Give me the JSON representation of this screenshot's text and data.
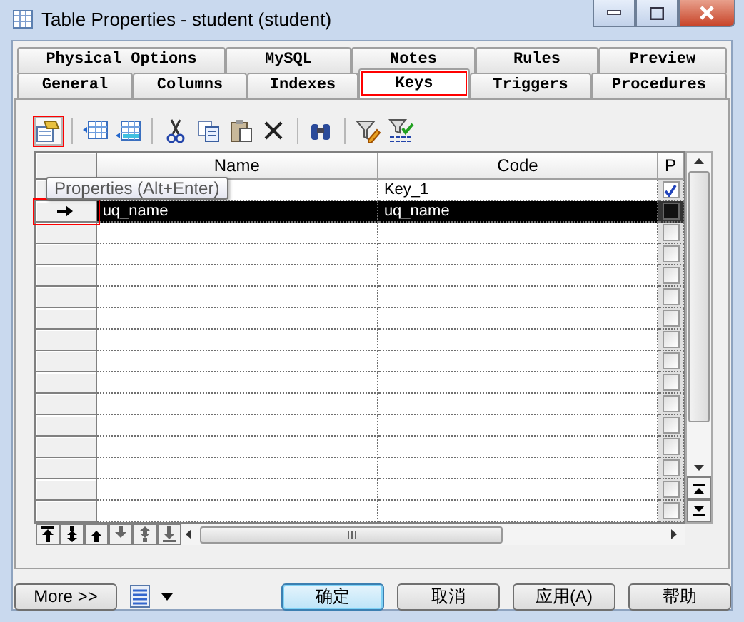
{
  "window": {
    "title": "Table Properties - student (student)"
  },
  "tab_rows": [
    [
      {
        "label": "Physical Options",
        "selected": false,
        "highlighted": false
      },
      {
        "label": "MySQL",
        "selected": false,
        "highlighted": false
      },
      {
        "label": "Notes",
        "selected": false,
        "highlighted": false
      },
      {
        "label": "Rules",
        "selected": false,
        "highlighted": false
      },
      {
        "label": "Preview",
        "selected": false,
        "highlighted": false
      }
    ],
    [
      {
        "label": "General",
        "selected": false,
        "highlighted": false
      },
      {
        "label": "Columns",
        "selected": false,
        "highlighted": false
      },
      {
        "label": "Indexes",
        "selected": false,
        "highlighted": false
      },
      {
        "label": "Keys",
        "selected": true,
        "highlighted": true
      },
      {
        "label": "Triggers",
        "selected": false,
        "highlighted": false
      },
      {
        "label": "Procedures",
        "selected": false,
        "highlighted": false
      }
    ]
  ],
  "toolbar": [
    {
      "kind": "properties",
      "highlighted": true
    },
    {
      "kind": "separator"
    },
    {
      "kind": "insert-row"
    },
    {
      "kind": "add-row"
    },
    {
      "kind": "separator"
    },
    {
      "kind": "cut"
    },
    {
      "kind": "copy"
    },
    {
      "kind": "paste"
    },
    {
      "kind": "delete"
    },
    {
      "kind": "separator"
    },
    {
      "kind": "find"
    },
    {
      "kind": "separator"
    },
    {
      "kind": "filter-edit"
    },
    {
      "kind": "filter-apply"
    }
  ],
  "tooltip": "Properties (Alt+Enter)",
  "grid": {
    "columns": [
      "Name",
      "Code",
      "P"
    ],
    "rows": [
      {
        "code": "Key_1",
        "primary": true,
        "selected": false,
        "current": false,
        "highlighted": false
      },
      {
        "name": "uq_name",
        "code": "uq_name",
        "primary": false,
        "selected": true,
        "current": true,
        "highlighted": true
      },
      {
        "primary": false,
        "selected": false,
        "current": false,
        "highlighted": false
      },
      {
        "primary": false,
        "selected": false,
        "current": false,
        "highlighted": false
      },
      {
        "primary": false,
        "selected": false,
        "current": false,
        "highlighted": false
      },
      {
        "primary": false,
        "selected": false,
        "current": false,
        "highlighted": false
      },
      {
        "primary": false,
        "selected": false,
        "current": false,
        "highlighted": false
      },
      {
        "primary": false,
        "selected": false,
        "current": false,
        "highlighted": false
      },
      {
        "primary": false,
        "selected": false,
        "current": false,
        "highlighted": false
      },
      {
        "primary": false,
        "selected": false,
        "current": false,
        "highlighted": false
      },
      {
        "primary": false,
        "selected": false,
        "current": false,
        "highlighted": false
      },
      {
        "primary": false,
        "selected": false,
        "current": false,
        "highlighted": false
      },
      {
        "primary": false,
        "selected": false,
        "current": false,
        "highlighted": false
      },
      {
        "primary": false,
        "selected": false,
        "current": false,
        "highlighted": false
      },
      {
        "primary": false,
        "selected": false,
        "current": false,
        "highlighted": false
      },
      {
        "primary": false,
        "selected": false,
        "current": false,
        "highlighted": false
      }
    ]
  },
  "move_buttons": [
    {
      "kind": "top"
    },
    {
      "kind": "page-up"
    },
    {
      "kind": "up"
    },
    {
      "kind": "down"
    },
    {
      "kind": "page-down"
    },
    {
      "kind": "bottom"
    }
  ],
  "footer": {
    "more": "More >>",
    "buttons": [
      {
        "label": "确定",
        "default": true
      },
      {
        "label": "取消",
        "default": false
      },
      {
        "label": "应用(A)",
        "default": false
      },
      {
        "label": "帮助",
        "default": false
      }
    ]
  }
}
